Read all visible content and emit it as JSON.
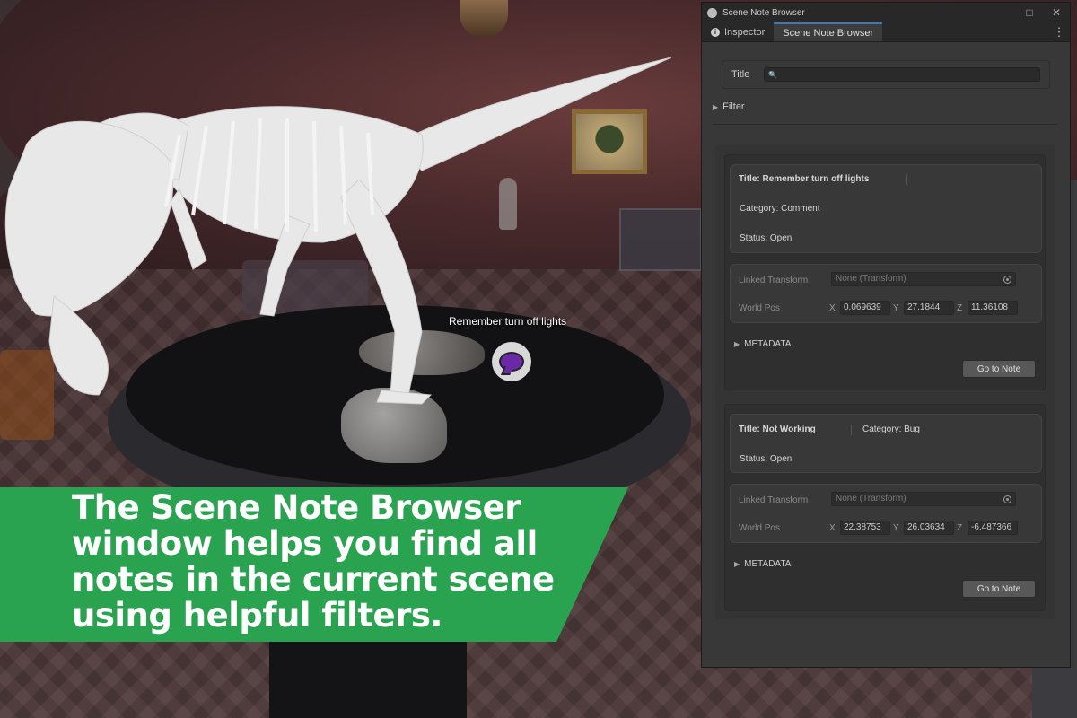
{
  "scene": {
    "note_label": "Remember turn off lights",
    "caption": "The Scene Note Browser window helps you find all notes in the current scene using helpful filters."
  },
  "window": {
    "title": "Scene Note Browser",
    "maximize_glyph": "□",
    "close_glyph": "✕",
    "more_glyph": "⋮",
    "tabs": [
      {
        "label": "Inspector",
        "icon": "info-icon",
        "active": false
      },
      {
        "label": "Scene Note Browser",
        "active": true
      }
    ],
    "search": {
      "label": "Title",
      "value": "",
      "icon_glyph": "🔍"
    },
    "filter": {
      "label": "Filter",
      "expand_glyph": "▶"
    }
  },
  "notes": [
    {
      "title": "Title: Remember turn off lights",
      "category": "Category: Comment",
      "status": "Status: Open",
      "linked_transform_label": "Linked Transform",
      "linked_transform_value": "None (Transform)",
      "world_pos_label": "World Pos",
      "x_label": "X",
      "x": "0.069639",
      "y_label": "Y",
      "y": "27.1844",
      "z_label": "Z",
      "z": "11.36108",
      "metadata_label": "METADATA",
      "button_label": "Go to Note"
    },
    {
      "title": "Title: Not Working",
      "category": "Category: Bug",
      "status": "Status: Open",
      "linked_transform_label": "Linked Transform",
      "linked_transform_value": "None (Transform)",
      "world_pos_label": "World Pos",
      "x_label": "X",
      "x": "22.38753",
      "y_label": "Y",
      "y": "26.03634",
      "z_label": "Z",
      "z": "-6.487366",
      "metadata_label": "METADATA",
      "button_label": "Go to Note"
    }
  ],
  "colors": {
    "accent": "#3a79bb",
    "caption_bg": "#2aa350",
    "panel_bg": "#383838",
    "marker_bubble": "#6a2aa8"
  }
}
